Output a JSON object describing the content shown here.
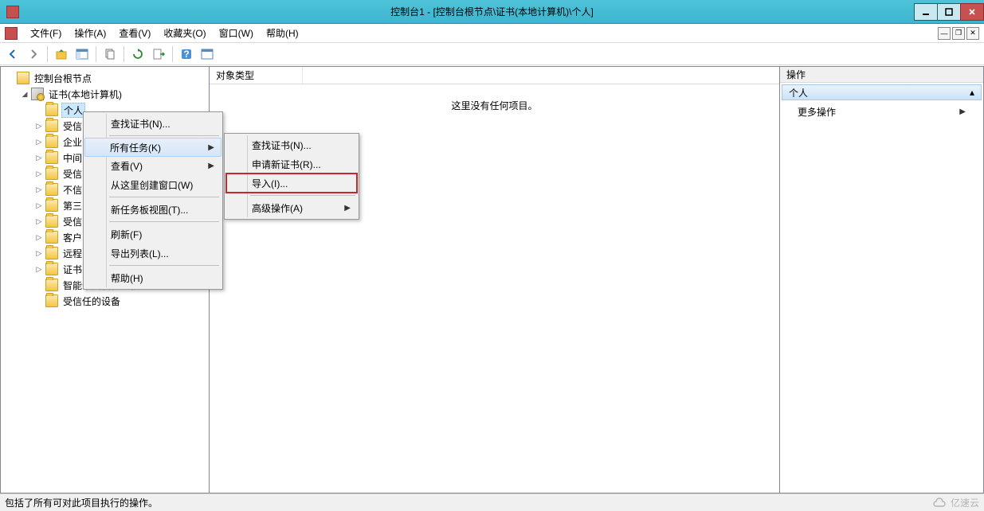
{
  "titlebar": {
    "title": "控制台1 - [控制台根节点\\证书(本地计算机)\\个人]"
  },
  "menubar": {
    "items": [
      {
        "label": "文件(F)"
      },
      {
        "label": "操作(A)"
      },
      {
        "label": "查看(V)"
      },
      {
        "label": "收藏夹(O)"
      },
      {
        "label": "窗口(W)"
      },
      {
        "label": "帮助(H)"
      }
    ]
  },
  "tree": {
    "root": "控制台根节点",
    "cert_root": "证书(本地计算机)",
    "nodes": [
      {
        "label": "个人",
        "selected": true
      },
      {
        "label": "受信"
      },
      {
        "label": "企业"
      },
      {
        "label": "中间"
      },
      {
        "label": "受信"
      },
      {
        "label": "不信"
      },
      {
        "label": "第三"
      },
      {
        "label": "受信"
      },
      {
        "label": "客户"
      },
      {
        "label": "远程"
      },
      {
        "label": "证书"
      }
    ],
    "tail": [
      {
        "label": "智能卡受信任的根"
      },
      {
        "label": "受信任的设备"
      }
    ]
  },
  "content": {
    "header_col": "对象类型",
    "empty_text": "这里没有任何项目。"
  },
  "actions": {
    "header": "操作",
    "section_title": "个人",
    "more": "更多操作"
  },
  "context_menu_main": {
    "items": [
      {
        "label": "查找证书(N)...",
        "sep_after": true
      },
      {
        "label": "所有任务(K)",
        "submenu": true,
        "highlight": true
      },
      {
        "label": "查看(V)",
        "submenu": true
      },
      {
        "label": "从这里创建窗口(W)",
        "sep_after": true
      },
      {
        "label": "新任务板视图(T)...",
        "sep_after": true
      },
      {
        "label": "刷新(F)"
      },
      {
        "label": "导出列表(L)...",
        "sep_after": true
      },
      {
        "label": "帮助(H)"
      }
    ]
  },
  "context_menu_sub": {
    "items": [
      {
        "label": "查找证书(N)..."
      },
      {
        "label": "申请新证书(R)..."
      },
      {
        "label": "导入(I)...",
        "red": true,
        "sep_after": true
      },
      {
        "label": "高级操作(A)",
        "submenu": true
      }
    ]
  },
  "statusbar": {
    "text": "包括了所有可对此项目执行的操作。",
    "watermark": "亿速云"
  }
}
